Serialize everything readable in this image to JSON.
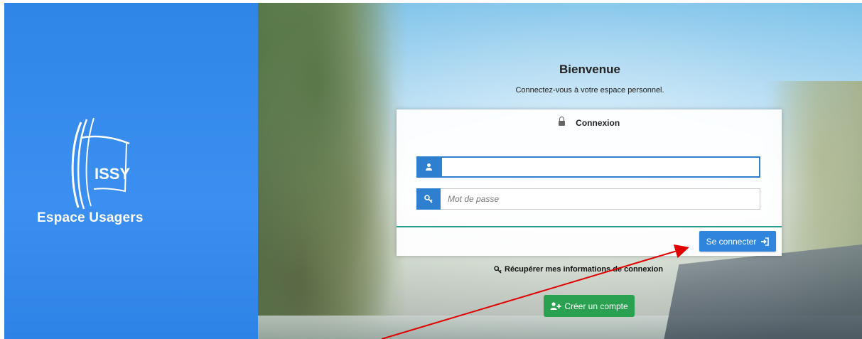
{
  "brand": {
    "logo_text": "ISSY",
    "title": "Espace Usagers",
    "color": "#2f86e6"
  },
  "welcome": {
    "title": "Bienvenue",
    "subtitle": "Connectez-vous à votre espace personnel."
  },
  "login_card": {
    "heading": "Connexion",
    "username": {
      "value": "",
      "placeholder": "",
      "icon": "user-icon"
    },
    "password": {
      "value": "",
      "placeholder": "Mot de passe",
      "icon": "key-icon"
    },
    "submit_label": "Se connecter",
    "submit_icon": "sign-in-icon",
    "accent_color": "#2f7fd1"
  },
  "recover_link": "Récupérer mes informations de connexion",
  "create_account": {
    "label": "Créer un compte",
    "color": "#2aa150",
    "icon": "user-plus-icon"
  },
  "annotation": {
    "color": "#e00000"
  }
}
